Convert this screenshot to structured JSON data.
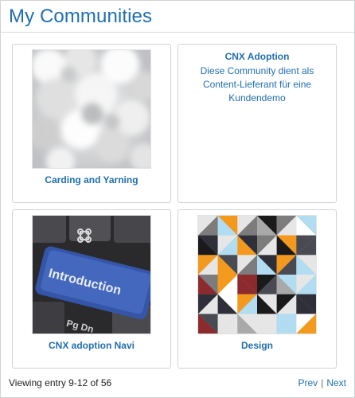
{
  "widget": {
    "title": "My Communities"
  },
  "communities": [
    {
      "name": "Carding and Yarning",
      "image": "clouds-photo"
    },
    {
      "name": "CNX Adoption",
      "description": "Diese Community dient als Content-Lieferant für eine Kundendemo"
    },
    {
      "name": "CNX adoption Navi",
      "image": "keyboard-introduction-key-photo",
      "key_label": "Introduction"
    },
    {
      "name": "Design",
      "image": "geometric-triangle-pattern"
    }
  ],
  "footer": {
    "status": "Viewing entry 9-12 of 56",
    "prev_label": "Prev",
    "separator": "|",
    "next_label": "Next"
  }
}
